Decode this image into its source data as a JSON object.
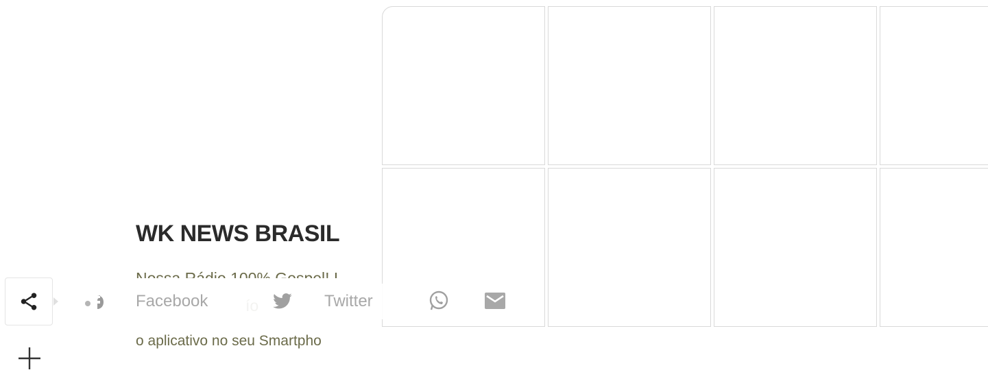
{
  "site": {
    "title": "WK NEWS BRASIL",
    "description_line1": "Nossa Rádio 100% Gospel! L",
    "description_line2_fragment": "ío",
    "description_line3": "o aplicativo no seu Smartpho"
  },
  "share": {
    "facebook_label": "Facebook",
    "twitter_label": "Twitter"
  },
  "icons": {
    "share": "share-icon",
    "facebook": "facebook-icon",
    "twitter": "twitter-icon",
    "whatsapp": "whatsapp-icon",
    "email": "email-icon",
    "plus": "plus-icon"
  },
  "colors": {
    "title": "#2b2b2b",
    "description": "#6b6b4a",
    "share_icon_gray": "#a8a8a8",
    "tile_border": "#d9d9d9"
  }
}
